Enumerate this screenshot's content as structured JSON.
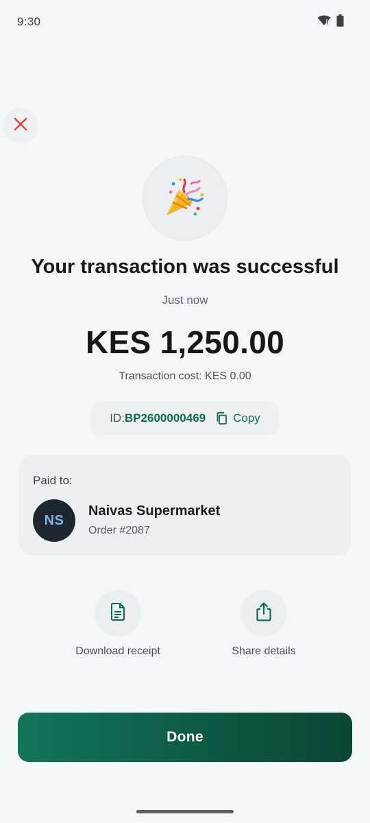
{
  "status_bar": {
    "time": "9:30",
    "icons": [
      "wifi-icon",
      "battery-icon"
    ]
  },
  "header": {
    "close_icon": "close-icon"
  },
  "hero": {
    "icon": "party-popper-icon",
    "title": "Your transaction was successful",
    "subtitle": "Just now",
    "amount": "KES 1,250.00",
    "transaction_cost": "Transaction cost: KES 0.00"
  },
  "transaction_id": {
    "prefix": "ID:",
    "value": "BP2600000469",
    "copy_label": "Copy"
  },
  "paid_to": {
    "label": "Paid to:",
    "initials": "NS",
    "name": "Naivas Supermarket",
    "order": "Order #2087"
  },
  "actions": [
    {
      "label": "Download receipt",
      "icon": "receipt-icon"
    },
    {
      "label": "Share details",
      "icon": "share-icon"
    }
  ],
  "done_label": "Done",
  "colors": {
    "accent": "#0f6b4f",
    "button_gradient_start": "#13745a",
    "button_gradient_end": "#0a4536",
    "close_red": "#e0453e",
    "avatar_bg": "#1e2630",
    "avatar_text": "#7fb3e8"
  }
}
